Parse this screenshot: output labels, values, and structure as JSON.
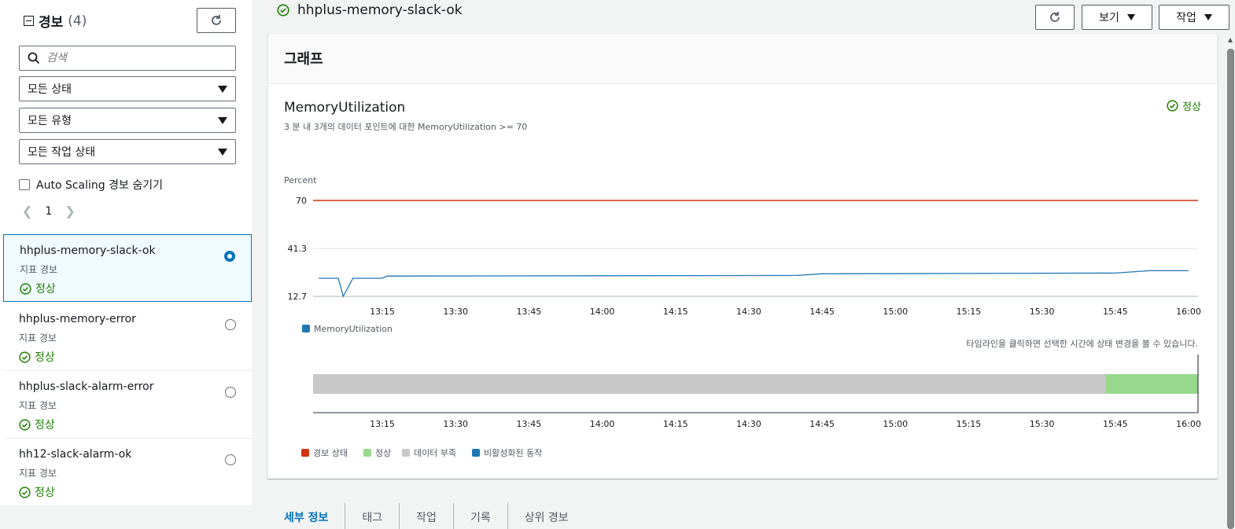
{
  "sidebar": {
    "title": "경보",
    "count": "(4)",
    "search_placeholder": "검색",
    "filters": [
      "모든 상태",
      "모든 유형",
      "모든 작업 상태"
    ],
    "hide_autoscaling_label": "Auto Scaling 경보 숨기기",
    "page": "1",
    "alarms": [
      {
        "name": "hhplus-memory-slack-ok",
        "type": "지표 경보",
        "state": "정상",
        "selected": true
      },
      {
        "name": "hhplus-memory-error",
        "type": "지표 경보",
        "state": "정상",
        "selected": false
      },
      {
        "name": "hhplus-slack-alarm-error",
        "type": "지표 경보",
        "state": "정상",
        "selected": false
      },
      {
        "name": "hh12-slack-alarm-ok",
        "type": "지표 경보",
        "state": "정상",
        "selected": false
      }
    ]
  },
  "header": {
    "alarm_name": "hhplus-memory-slack-ok",
    "view_label": "보기",
    "actions_label": "작업"
  },
  "graph": {
    "panel_title": "그래프",
    "metric_title": "MemoryUtilization",
    "metric_subtitle": "3 분 내 3개의 데이터 포인트에 대한 MemoryUtilization >= 70",
    "state": "정상",
    "timeline_hint": "타임라인을 클릭하면 선택한 시간에 상태 변경을 볼 수 있습니다."
  },
  "chart_data": [
    {
      "type": "line",
      "ylabel": "Percent",
      "yticks": [
        "70",
        "41.3",
        "12.7"
      ],
      "ylim": [
        12.7,
        70
      ],
      "x_ticks": [
        "13:15",
        "13:30",
        "13:45",
        "14:00",
        "14:15",
        "14:30",
        "14:45",
        "15:00",
        "15:15",
        "15:30",
        "15:45",
        "16:00"
      ],
      "threshold": 70,
      "series": [
        {
          "name": "MemoryUtilization",
          "color": "#1f77b4",
          "points": [
            [
              "13:02",
              23.5
            ],
            [
              "13:06",
              23.5
            ],
            [
              "13:07",
              12.7
            ],
            [
              "13:09",
              23.5
            ],
            [
              "13:15",
              23.5
            ],
            [
              "13:16",
              24.8
            ],
            [
              "14:00",
              25
            ],
            [
              "14:40",
              25.2
            ],
            [
              "14:45",
              26.2
            ],
            [
              "15:45",
              26.6
            ],
            [
              "15:52",
              28
            ],
            [
              "16:00",
              28
            ]
          ]
        }
      ],
      "legend": "bottom-left"
    },
    {
      "type": "timeline",
      "x_ticks": [
        "13:15",
        "13:30",
        "13:45",
        "14:00",
        "14:15",
        "14:30",
        "14:45",
        "15:00",
        "15:15",
        "15:30",
        "15:45",
        "16:00"
      ],
      "segments": [
        {
          "state": "데이터 부족",
          "from": "13:00",
          "to": "15:43"
        },
        {
          "state": "정상",
          "from": "15:43",
          "to": "16:02"
        }
      ],
      "legend": [
        {
          "label": "경보 상태",
          "color": "#d13212"
        },
        {
          "label": "정상",
          "color": "#98d98e"
        },
        {
          "label": "데이터 부족",
          "color": "#c8c8c8"
        },
        {
          "label": "비활성화된 동작",
          "color": "#1f77b4"
        }
      ]
    }
  ],
  "tabs": [
    "세부 정보",
    "태그",
    "작업",
    "기록",
    "상위 경보"
  ],
  "colors": {
    "accent": "#0073bb",
    "ok": "#1d8102",
    "threshold": "#d13212"
  }
}
